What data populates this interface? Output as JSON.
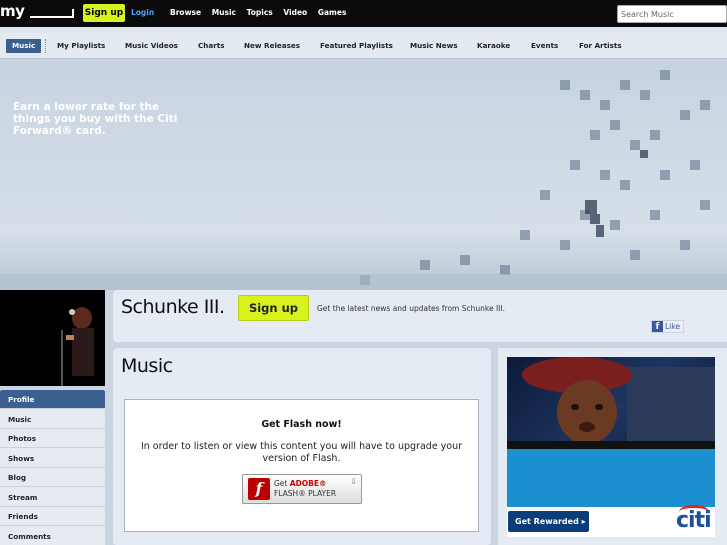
{
  "topbar": {
    "logo": "my",
    "signup": "Sign up",
    "login": "Login",
    "nav": [
      "Browse",
      "Music",
      "Topics",
      "Video",
      "Games"
    ],
    "search_placeholder": "Search Music"
  },
  "subnav": {
    "items": [
      "Music",
      "My Playlists",
      "Music Videos",
      "Charts",
      "New Releases",
      "Featured Playlists",
      "Music News",
      "Karaoke",
      "Events",
      "For Artists"
    ]
  },
  "header": {
    "artist": "Schunke III.",
    "signup": "Sign up",
    "tagline": "Get the latest news and updates from Schunke III.",
    "like": "Like"
  },
  "sidebar": {
    "items": [
      "Profile",
      "Music",
      "Photos",
      "Shows",
      "Blog",
      "Stream",
      "Friends",
      "Comments"
    ]
  },
  "main": {
    "title": "Music",
    "flash_title": "Get Flash now!",
    "flash_message": "In order to listen or view this content you will have to upgrade your version of Flash.",
    "flash_btn_get": "Get",
    "flash_btn_adobe": "ADOBE®",
    "flash_btn_player": "FLASH® PLAYER"
  },
  "ad": {
    "text": "Earn a lower rate for the things you buy with the Citi Forward® card.",
    "button": "Get Rewarded",
    "logo": "citi"
  },
  "colors": {
    "accent": "#d8f21e",
    "nav_active": "#3b5f8f",
    "ad_blue": "#1c8fd1"
  }
}
